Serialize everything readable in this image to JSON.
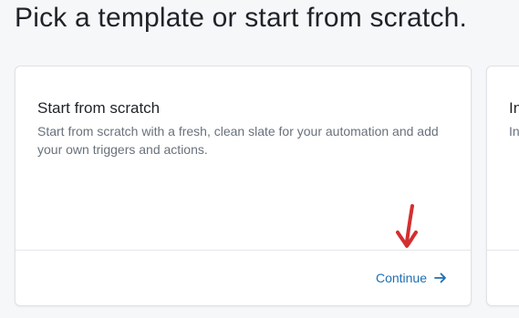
{
  "page": {
    "headline": "Pick a template or start from scratch."
  },
  "cards": [
    {
      "title": "Start from scratch",
      "description": "Start from scratch with a fresh, clean slate for your automation and add your own triggers and actions.",
      "action_label": "Continue",
      "action_icon": "arrow-right-icon"
    },
    {
      "title": "In",
      "description": "In"
    }
  ],
  "annotation": {
    "icon": "red-arrow-down-icon",
    "color": "#d32f2f"
  },
  "colors": {
    "background": "#f6f7f9",
    "card": "#ffffff",
    "link": "#1f6fb2",
    "muted_text": "#69717b"
  }
}
